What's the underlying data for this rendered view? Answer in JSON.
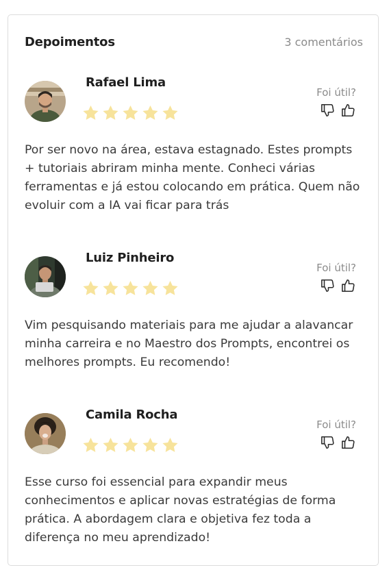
{
  "header": {
    "title": "Depoimentos",
    "count": "3 comentários"
  },
  "colors": {
    "star": "#f7e39b",
    "border": "#dcdcdc",
    "muted": "#8b8b8b"
  },
  "reviews": [
    {
      "name": "Rafael Lima",
      "rating": 5,
      "helpful_label": "Foi útil?",
      "text": "Por ser novo na área, estava estagnado. Estes prompts + tutoriais abriram minha mente. Conheci várias ferramentas e já estou colocando em prática. Quem não evoluir com a IA vai ficar para trás"
    },
    {
      "name": "Luiz Pinheiro",
      "rating": 5,
      "helpful_label": "Foi útil?",
      "text": "Vim pesquisando materiais para me ajudar a alavancar minha carreira e no Maestro dos Prompts, encontrei os melhores prompts. Eu recomendo!"
    },
    {
      "name": "Camila Rocha",
      "rating": 5,
      "helpful_label": "Foi útil?",
      "text": "Esse curso foi essencial para expandir meus conhecimentos e aplicar novas estratégias de forma prática. A abordagem clara e objetiva fez toda a diferença no meu aprendizado!"
    }
  ]
}
